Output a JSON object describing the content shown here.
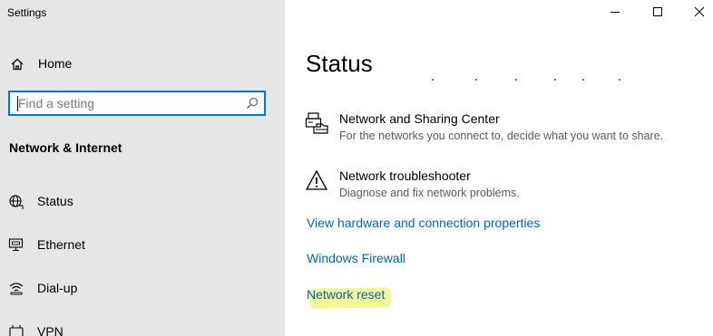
{
  "window": {
    "title": "Settings",
    "controls": [
      "minimize-icon",
      "maximize-icon",
      "close-icon"
    ]
  },
  "sidebar": {
    "home_label": "Home",
    "search": {
      "placeholder": "Find a setting",
      "value": "",
      "icon": "search-icon"
    },
    "section_heading": "Network & Internet",
    "items": [
      {
        "label": "Status",
        "icon": "globe-icon"
      },
      {
        "label": "Ethernet",
        "icon": "monitor-icon"
      },
      {
        "label": "Dial-up",
        "icon": "signal-icon"
      },
      {
        "label": "VPN",
        "icon": "vpn-icon"
      }
    ]
  },
  "main": {
    "title": "Status",
    "entries": [
      {
        "title": "Network and Sharing Center",
        "description": "For the networks you connect to, decide what you want to share.",
        "icon": "printer-network-icon"
      },
      {
        "title": "Network troubleshooter",
        "description": "Diagnose and fix network problems.",
        "icon": "warning-icon"
      }
    ],
    "links": [
      {
        "label": "View hardware and connection properties"
      },
      {
        "label": "Windows Firewall"
      },
      {
        "label": "Network reset",
        "highlighted": true
      }
    ]
  },
  "colors": {
    "accent": "#0078d7",
    "link": "#0066b4",
    "sidebar_bg": "#e6e6e6",
    "highlight": "#f5f59a"
  }
}
